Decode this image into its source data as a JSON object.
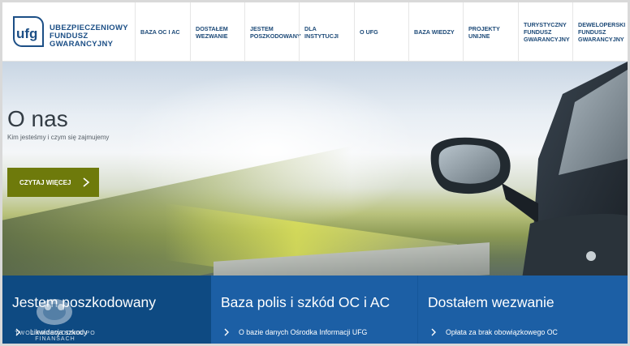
{
  "logo": {
    "mark": "ufg",
    "lines": [
      "UBEZPIECZENIOWY",
      "FUNDUSZ",
      "GWARANCYJNY"
    ]
  },
  "nav": [
    {
      "lines": [
        "BAZA OC I AC"
      ]
    },
    {
      "lines": [
        "DOSTAŁEM",
        "WEZWANIE"
      ]
    },
    {
      "lines": [
        "JESTEM",
        "POSZKODOWANY"
      ]
    },
    {
      "lines": [
        "DLA",
        "INSTYTUCJI"
      ]
    },
    {
      "lines": [
        "O UFG"
      ]
    },
    {
      "lines": [
        "BAZA WIEDZY"
      ]
    },
    {
      "lines": [
        "PROJEKTY",
        "UNIJNE"
      ]
    },
    {
      "lines": [
        "TURYSTYCZNY",
        "FUNDUSZ",
        "GWARANCYJNY"
      ]
    },
    {
      "lines": [
        "DEWELOPERSKI",
        "FUNDUSZ",
        "GWARANCYJNY"
      ]
    }
  ],
  "hero": {
    "title": "O nas",
    "subtitle": "Kim jesteśmy i czym się zajmujemy",
    "button": "CZYTAJ WIĘCEJ"
  },
  "tiles": [
    {
      "title": "Jestem poszkodowany",
      "link": "Likwidacja szkody"
    },
    {
      "title": "Baza polis i szkód OC i AC",
      "link": "O bazie danych Ośrodka Informacji UFG"
    },
    {
      "title": "Dostałem wezwanie",
      "link": "Opłata za brak obowiązkowego OC"
    }
  ],
  "watermark": {
    "text": "TWOJ PRZEWODNIK PO FINANSACH"
  },
  "colors": {
    "brand_blue": "#1c4f86",
    "button_olive": "#6e7a0b",
    "tile_dark": "#0e4a82",
    "tile_blue": "#1c5fa5"
  }
}
